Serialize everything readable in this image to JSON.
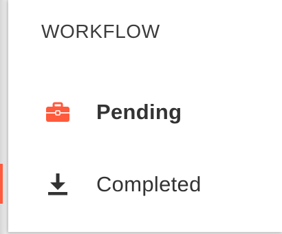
{
  "colors": {
    "accent": "#ff5a3c",
    "text": "#333333",
    "panel_bg": "#ffffff",
    "backdrop": "#e6e6e6"
  },
  "section": {
    "title": "WORKFLOW"
  },
  "menu": {
    "items": [
      {
        "label": "Pending",
        "icon": "briefcase-icon",
        "active": true
      },
      {
        "label": "Completed",
        "icon": "download-icon",
        "active": false
      }
    ]
  }
}
